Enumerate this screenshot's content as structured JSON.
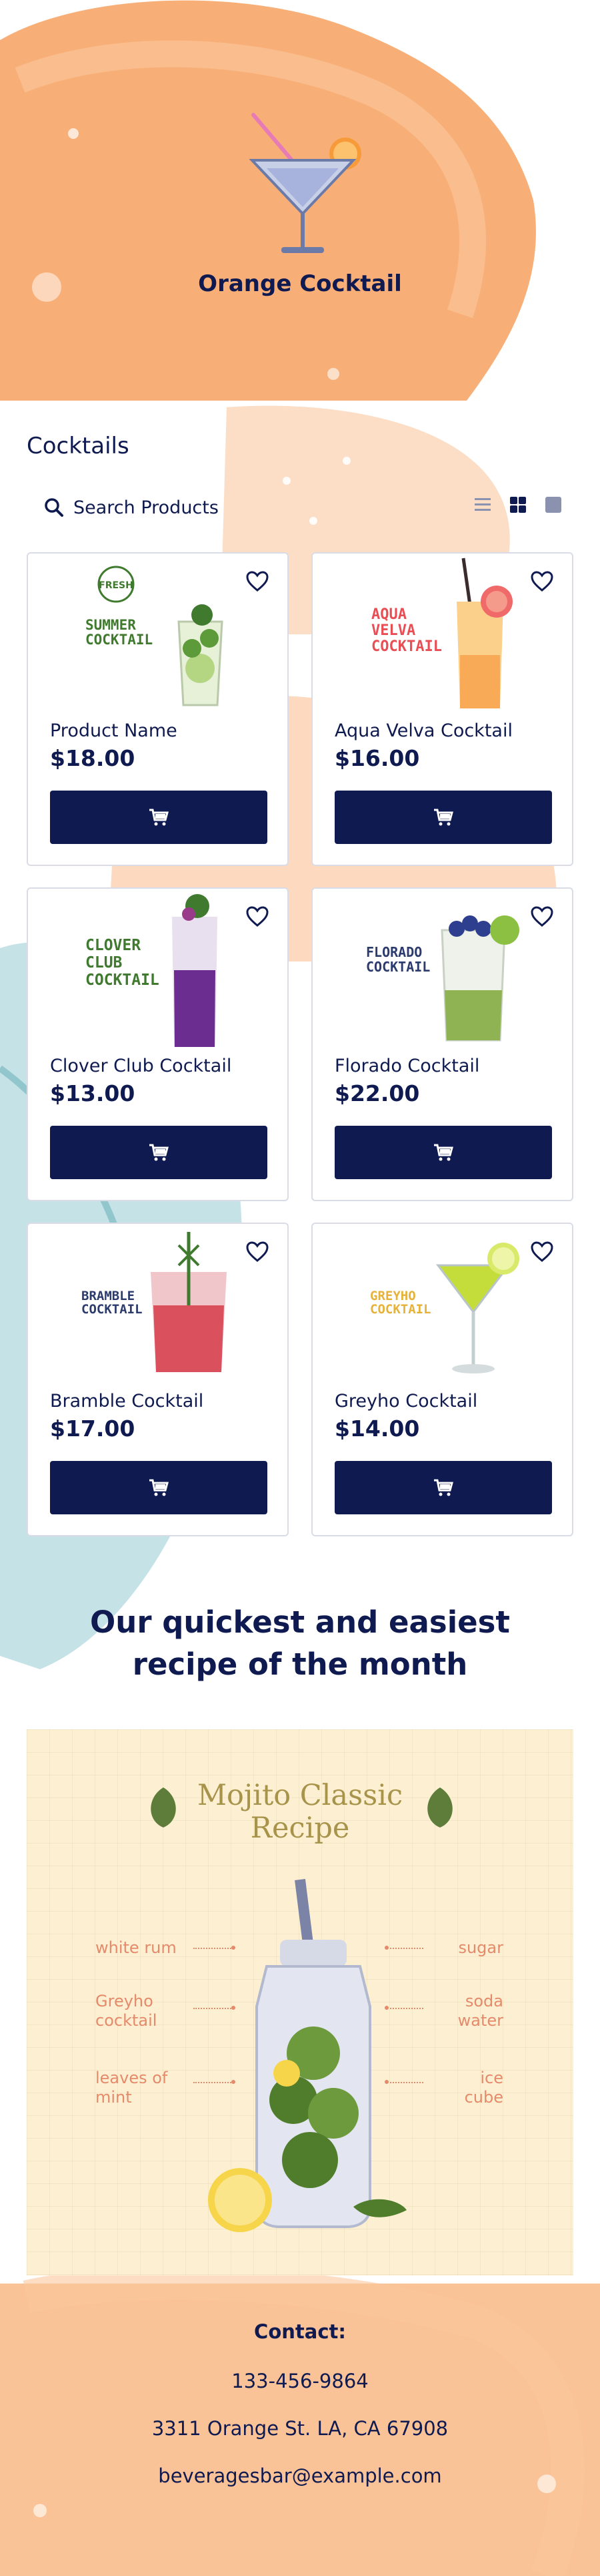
{
  "header": {
    "title": "Orange Cocktail",
    "logo_icon": "cocktail-glass-icon"
  },
  "products_section": {
    "title": "Cocktails",
    "search_placeholder": "Search Products",
    "view_modes": [
      "list-view-icon",
      "grid-view-icon",
      "single-view-icon"
    ],
    "products": [
      {
        "name": "Product Name",
        "price": "$18.00",
        "image_text": "SUMMER COCKTAIL",
        "badge": "FRESH",
        "image_color": "#3f7a2e"
      },
      {
        "name": "Aqua Velva Cocktail",
        "price": "$16.00",
        "image_text": "AQUA VELVA COCKTAIL",
        "image_color": "#e84f55"
      },
      {
        "name": "Clover Club Cocktail",
        "price": "$13.00",
        "image_text": "CLOVER CLUB COCKTAIL",
        "image_color": "#3f7a2e"
      },
      {
        "name": "Florado Cocktail",
        "price": "$22.00",
        "image_text": "FLORADO COCKTAIL",
        "image_color": "#2c3b6e"
      },
      {
        "name": "Bramble Cocktail",
        "price": "$17.00",
        "image_text": "BRAMBLE COCKTAIL",
        "image_color": "#2c3b6e"
      },
      {
        "name": "Greyho Cocktail",
        "price": "$14.00",
        "image_text": "GREYHO COCKTAIL",
        "image_color": "#e6b23a"
      }
    ]
  },
  "recipe": {
    "heading": "Our quickest and easiest recipe of the month",
    "title_line1": "Mojito Classic",
    "title_line2": "Recipe",
    "ingredients_left": [
      "white rum",
      "Greyho cocktail",
      "leaves of mint"
    ],
    "ingredients_right": [
      "sugar",
      "soda water",
      "ice cube"
    ]
  },
  "contact": {
    "title": "Contact:",
    "phone": "133-456-9864",
    "address": "3311 Orange St. LA, CA 67908",
    "email": "beveragesbar@example.com"
  },
  "colors": {
    "primary": "#0f1b50",
    "accent_orange": "#f7a15f",
    "recipe_bg": "#fdf0d2",
    "recipe_text": "#e58a6b"
  }
}
